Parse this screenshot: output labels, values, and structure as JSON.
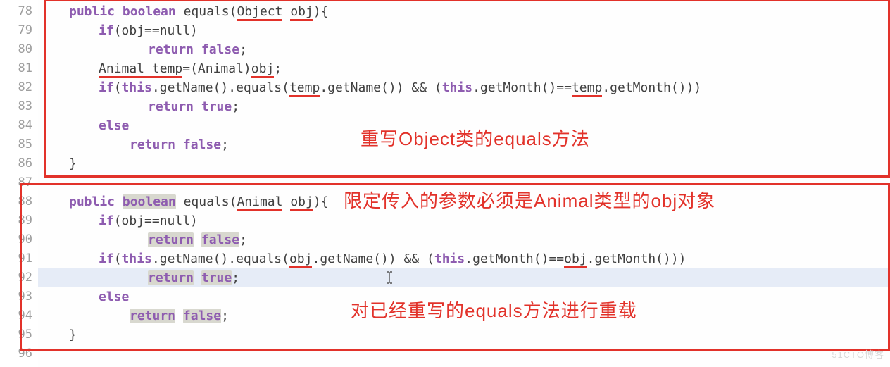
{
  "gutter": {
    "start": 78,
    "end": 96
  },
  "styles": {
    "keywordColor": "#8e5cb0",
    "highlightBg": "#d8d8cf",
    "underlineColor": "#e2322a",
    "lineHighlight": "#e6ecf7",
    "gutterColor": "#9e9e9e"
  },
  "code": {
    "l78": {
      "kw_public": "public",
      "kw_boolean": "boolean",
      "equals": "equals",
      "param_type": "Object",
      "param_name": "obj",
      "brace": "){"
    },
    "l79": {
      "kw_if": "if",
      "expr": "(obj==null)"
    },
    "l80": {
      "kw_return": "return",
      "kw_false": "false",
      "semi": ";"
    },
    "l81": {
      "type": "Animal",
      "var": "temp",
      "assign": "=(Animal)",
      "obj": "obj",
      "semi": ";"
    },
    "l82": {
      "kw_if": "if",
      "pre": "(",
      "kw_this1": "this",
      "mid1": ".getName().equals(",
      "temp1": "temp",
      "mid2": ".getName()) && (",
      "kw_this2": "this",
      "mid3": ".getMonth()==",
      "temp2": "temp",
      "end": ".getMonth()))"
    },
    "l83": {
      "kw_return": "return",
      "kw_true": "true",
      "semi": ";"
    },
    "l84": {
      "kw_else": "else"
    },
    "l85": {
      "kw_return": "return",
      "kw_false": "false",
      "semi": ";"
    },
    "l86": {
      "brace": "}"
    },
    "l88": {
      "kw_public": "public",
      "kw_boolean": "boolean",
      "equals": "equals",
      "param_type": "Animal",
      "param_name": "obj",
      "brace": "){"
    },
    "l89": {
      "kw_if": "if",
      "expr": "(obj==null)"
    },
    "l90": {
      "kw_return": "return",
      "kw_false": "false",
      "semi": ";"
    },
    "l91": {
      "kw_if": "if",
      "pre": "(",
      "kw_this1": "this",
      "mid1": ".getName().equals(",
      "obj1": "obj",
      "mid2": ".getName()) && (",
      "kw_this2": "this",
      "mid3": ".getMonth()==",
      "obj2": "obj",
      "end": ".getMonth()))"
    },
    "l92": {
      "kw_return": "return",
      "kw_true": "true",
      "semi": ";"
    },
    "l93": {
      "kw_else": "else"
    },
    "l94": {
      "kw_return": "return",
      "kw_false": "false",
      "semi": ";"
    },
    "l95": {
      "brace": "}"
    }
  },
  "annotations": {
    "a1": "重写Object类的equals方法",
    "a2": "限定传入的参数必须是Animal类型的obj对象",
    "a3": "对已经重写的equals方法进行重载"
  },
  "watermark": "51CTO博客"
}
